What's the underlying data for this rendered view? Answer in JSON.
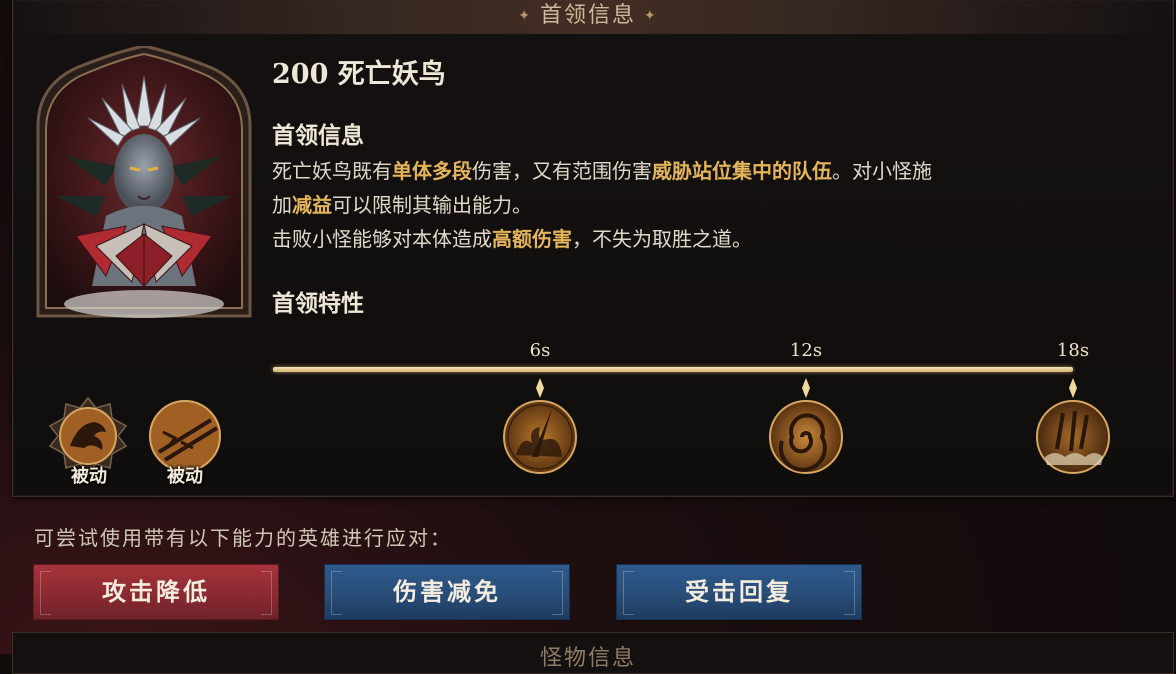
{
  "header": {
    "title": "首领信息"
  },
  "boss": {
    "name": "200 死亡妖鸟"
  },
  "info": {
    "title": "首领信息",
    "line1": [
      {
        "t": "死亡妖鸟既有",
        "h": false
      },
      {
        "t": "单体多段",
        "h": true
      },
      {
        "t": "伤害，又有范围伤害",
        "h": false
      },
      {
        "t": "威胁站位集中的队伍",
        "h": true
      },
      {
        "t": "。对小怪施",
        "h": false
      }
    ],
    "line2": [
      {
        "t": "加",
        "h": false
      },
      {
        "t": "减益",
        "h": true
      },
      {
        "t": "可以限制其输出能力。",
        "h": false
      }
    ],
    "line3": [
      {
        "t": "击败小怪能够对本体造成",
        "h": false
      },
      {
        "t": "高额伤害",
        "h": true
      },
      {
        "t": "，不失为取胜之道。",
        "h": false
      }
    ]
  },
  "traits": {
    "title": "首领特性"
  },
  "timeline": {
    "ticks": [
      {
        "label": "6s",
        "icon": "flame-slash-icon"
      },
      {
        "label": "12s",
        "icon": "vortex-icon"
      },
      {
        "label": "18s",
        "icon": "feather-rain-icon"
      }
    ]
  },
  "passives": [
    {
      "label": "被动",
      "icon": "eagle-icon"
    },
    {
      "label": "被动",
      "icon": "feather-crossed-icon"
    }
  ],
  "counter": {
    "hint": "可尝试使用带有以下能力的英雄进行应对：",
    "tags": [
      {
        "label": "攻击降低",
        "color": "#a8333a"
      },
      {
        "label": "伤害减免",
        "color": "#2f5a8c"
      },
      {
        "label": "受击回复",
        "color": "#2f5a8c"
      }
    ]
  },
  "bottom": {
    "title": "怪物信息"
  },
  "colors": {
    "highlight": "#e4b45a",
    "gold": "#d1b071"
  }
}
